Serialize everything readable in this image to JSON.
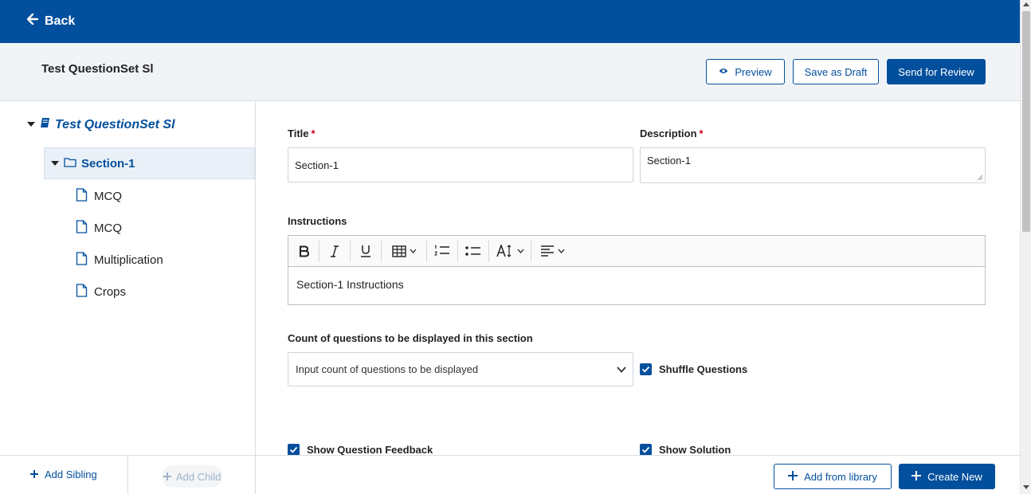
{
  "header": {
    "back_label": "Back"
  },
  "subheader": {
    "title": "Test QuestionSet Sl",
    "preview_label": "Preview",
    "save_draft_label": "Save as Draft",
    "send_review_label": "Send for Review"
  },
  "tree": {
    "root_label": "Test QuestionSet Sl",
    "section_label": "Section-1",
    "items": [
      {
        "label": "MCQ"
      },
      {
        "label": "MCQ"
      },
      {
        "label": "Multiplication"
      },
      {
        "label": "Crops"
      }
    ]
  },
  "sidebar_footer": {
    "add_sibling_label": "Add Sibling",
    "add_child_label": "Add Child"
  },
  "form": {
    "title_label": "Title",
    "title_value": "Section-1",
    "description_label": "Description",
    "description_value": "Section-1",
    "required_mark": "*",
    "instructions_label": "Instructions",
    "instructions_value": "Section-1 Instructions",
    "count_label": "Count of questions to be displayed in this section",
    "count_placeholder": "Input count of questions to be displayed",
    "shuffle_label": "Shuffle Questions",
    "feedback_label": "Show Question Feedback",
    "solution_label": "Show Solution"
  },
  "bottombar": {
    "add_library_label": "Add from library",
    "create_new_label": "Create New"
  },
  "colors": {
    "primary": "#024f9d",
    "required": "#d0021b"
  }
}
